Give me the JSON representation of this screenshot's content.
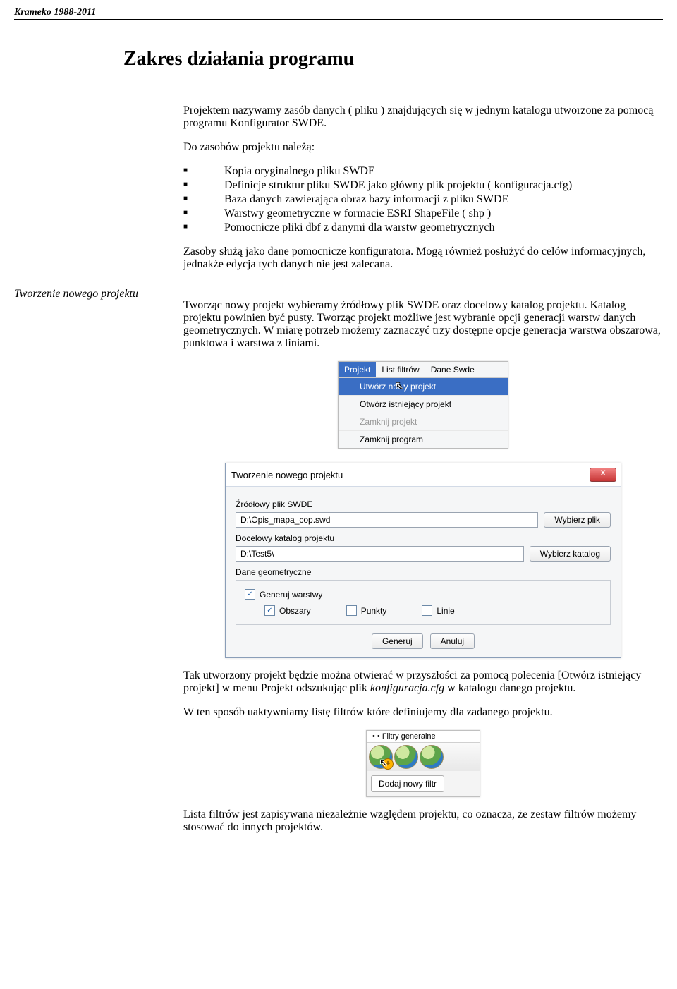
{
  "header": "Krameko 1988-2011",
  "title": "Zakres działania programu",
  "intro": "Projektem  nazywamy zasób danych ( pliku ) znajdujących się w jednym katalogu utworzone za pomocą programu Konfigurator SWDE.",
  "resources_intro": "Do zasobów projektu należą:",
  "bullets": [
    "Kopia oryginalnego pliku SWDE",
    "Definicje struktur pliku SWDE jako główny plik projektu ( konfiguracja.cfg)",
    "Baza danych zawierająca obraz bazy informacji z pliku SWDE",
    "Warstwy geometryczne w formacie ESRI ShapeFile ( shp )",
    "Pomocnicze pliki dbf z danymi dla warstw geometrycznych"
  ],
  "resources_note": "Zasoby służą jako dane pomocnicze konfiguratora. Mogą również posłużyć do celów informacyjnych, jednakże edycja tych danych nie jest zalecana.",
  "section2_label": "Tworzenie nowego projektu",
  "section2_text": "Tworząc nowy projekt wybieramy źródłowy plik SWDE oraz docelowy katalog projektu. Katalog projektu powinien być pusty. Tworząc projekt możliwe jest wybranie opcji generacji warstw danych geometrycznych. W miarę potrzeb możemy zaznaczyć trzy dostępne opcje generacja warstwa obszarowa, punktowa i warstwa z liniami.",
  "menu": {
    "bar": [
      "Projekt",
      "List filtrów",
      "Dane Swde"
    ],
    "items": {
      "create": "Utwórz nowy projekt",
      "open": "Otwórz istniejący projekt",
      "closep": "Zamknij projekt",
      "exit": "Zamknij program"
    }
  },
  "dialog": {
    "title": "Tworzenie nowego projektu",
    "src_label": "Źródłowy plik SWDE",
    "src_value": "D:\\Opis_mapa_cop.swd",
    "pick_file": "Wybierz plik",
    "dst_label": "Docelowy katalog projektu",
    "dst_value": "D:\\Test5\\",
    "pick_dir": "Wybierz katalog",
    "geo_label": "Dane geometryczne",
    "gen_layers": "Generuj warstwy",
    "cb_obszary": "Obszary",
    "cb_punkty": "Punkty",
    "cb_linie": "Linie",
    "btn_gen": "Generuj",
    "btn_cancel": "Anuluj"
  },
  "after_dialog_p1": "Tak utworzony projekt będzie można otwierać w przyszłości za pomocą polecenia [Otwórz istniejący projekt] w menu Projekt odszukując plik ",
  "after_dialog_em": "konfiguracja.cfg",
  "after_dialog_p1b": " w katalogu danego projektu.",
  "after_dialog_p2": "W ten sposób uaktywniamy listę filtrów które definiujemy dla zadanego projektu.",
  "toolbar": {
    "tab": "• • Filtry generalne",
    "tooltip": "Dodaj nowy filtr"
  },
  "final_p": "Lista filtrów jest zapisywana niezależnie względem projektu, co oznacza, że zestaw filtrów możemy stosować do innych projektów."
}
